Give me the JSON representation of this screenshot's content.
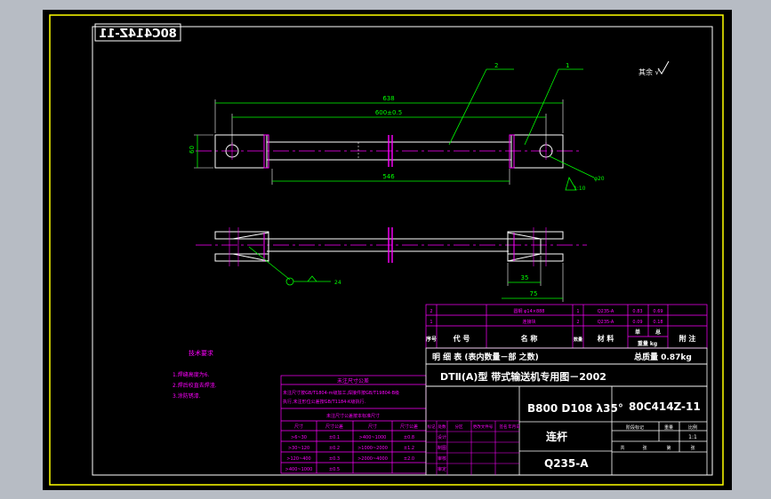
{
  "drawing": {
    "number": "80C414Z-11",
    "mirrored_stamp": "80C414Z-11",
    "title_line": "DTⅡ(A)型  带式输送机专用图－2002",
    "spec": "B800 D108 λ35°",
    "code": "80C414Z-11",
    "part_name": "连杆",
    "material": "Q235-A",
    "scale": "1:1",
    "roughness": "其余 √",
    "colors": {
      "background": "#000000",
      "frame": "#ffff00",
      "outline": "#ffffff",
      "center": "#ff00ff",
      "dimension": "#00ff00",
      "text": "#ffffff",
      "table": "#ff00ff"
    }
  },
  "dimensions": {
    "overall_length": "638",
    "hole_spacing": "600±0.5",
    "bar_length": "546",
    "height": "60",
    "hole_dia": "φ20",
    "width_35": "35",
    "width_75": "75",
    "slope": "1:10",
    "leader_1": "2",
    "leader_2": "1",
    "small_label": "24"
  },
  "parts_table": {
    "rows": [
      {
        "seq": "2",
        "code": "",
        "name": "圆钢 φ14×888",
        "qty": "1",
        "material": "Q235-A",
        "unit_wt": "0.83",
        "total_wt": "0.69"
      },
      {
        "seq": "1",
        "code": "",
        "name": "连接块",
        "qty": "2",
        "material": "Q235-A",
        "unit_wt": "0.09",
        "total_wt": "0.18"
      }
    ],
    "header": {
      "seq": "序号",
      "code": "代  号",
      "name": "名  称",
      "qty": "数量",
      "material": "材  料",
      "single": "单",
      "total": "总",
      "weight": "重量 kg",
      "note": "附  注"
    },
    "summary_label": "明  细  表  (表内数量－部 之数)",
    "summary_weight": "总质量 0.87kg"
  },
  "tech_notes": {
    "title": "技术要求",
    "items": [
      "1.焊缝高度为6.",
      "2.焊后校直去焊渣.",
      "3.涂防锈漆."
    ]
  },
  "tolerance_table": {
    "title": "未注尺寸公差",
    "note_lines": [
      "未注尺寸按GB/T1804-m级加工,焊接件按GB/T19804-B级",
      "执行,未注形位公差按GB/T1184-K级执行."
    ],
    "subtitle": "未注尺寸公差按本标准尺寸",
    "headers": [
      "尺寸",
      "尺寸公差",
      "尺寸",
      "尺寸公差"
    ],
    "rows": [
      [
        ">6~30",
        "±0.1",
        ">400~1000",
        "±0.8"
      ],
      [
        ">30~120",
        "±0.2",
        ">1000~2000",
        "±1.2"
      ],
      [
        ">120~400",
        "±0.3",
        ">2000~4000",
        "±2.0"
      ],
      [
        ">400~1000",
        "±0.5",
        "",
        ""
      ]
    ]
  },
  "sign_block": {
    "labels": [
      "设计",
      "制图",
      "审核",
      "审定"
    ],
    "header": [
      "标记",
      "处数",
      "分区",
      "更改文件号",
      "签名",
      "年月日"
    ],
    "columns": [
      "阶段标记",
      "重量",
      "比例"
    ],
    "sheet_labels": [
      "共",
      "张",
      "第",
      "张"
    ]
  }
}
